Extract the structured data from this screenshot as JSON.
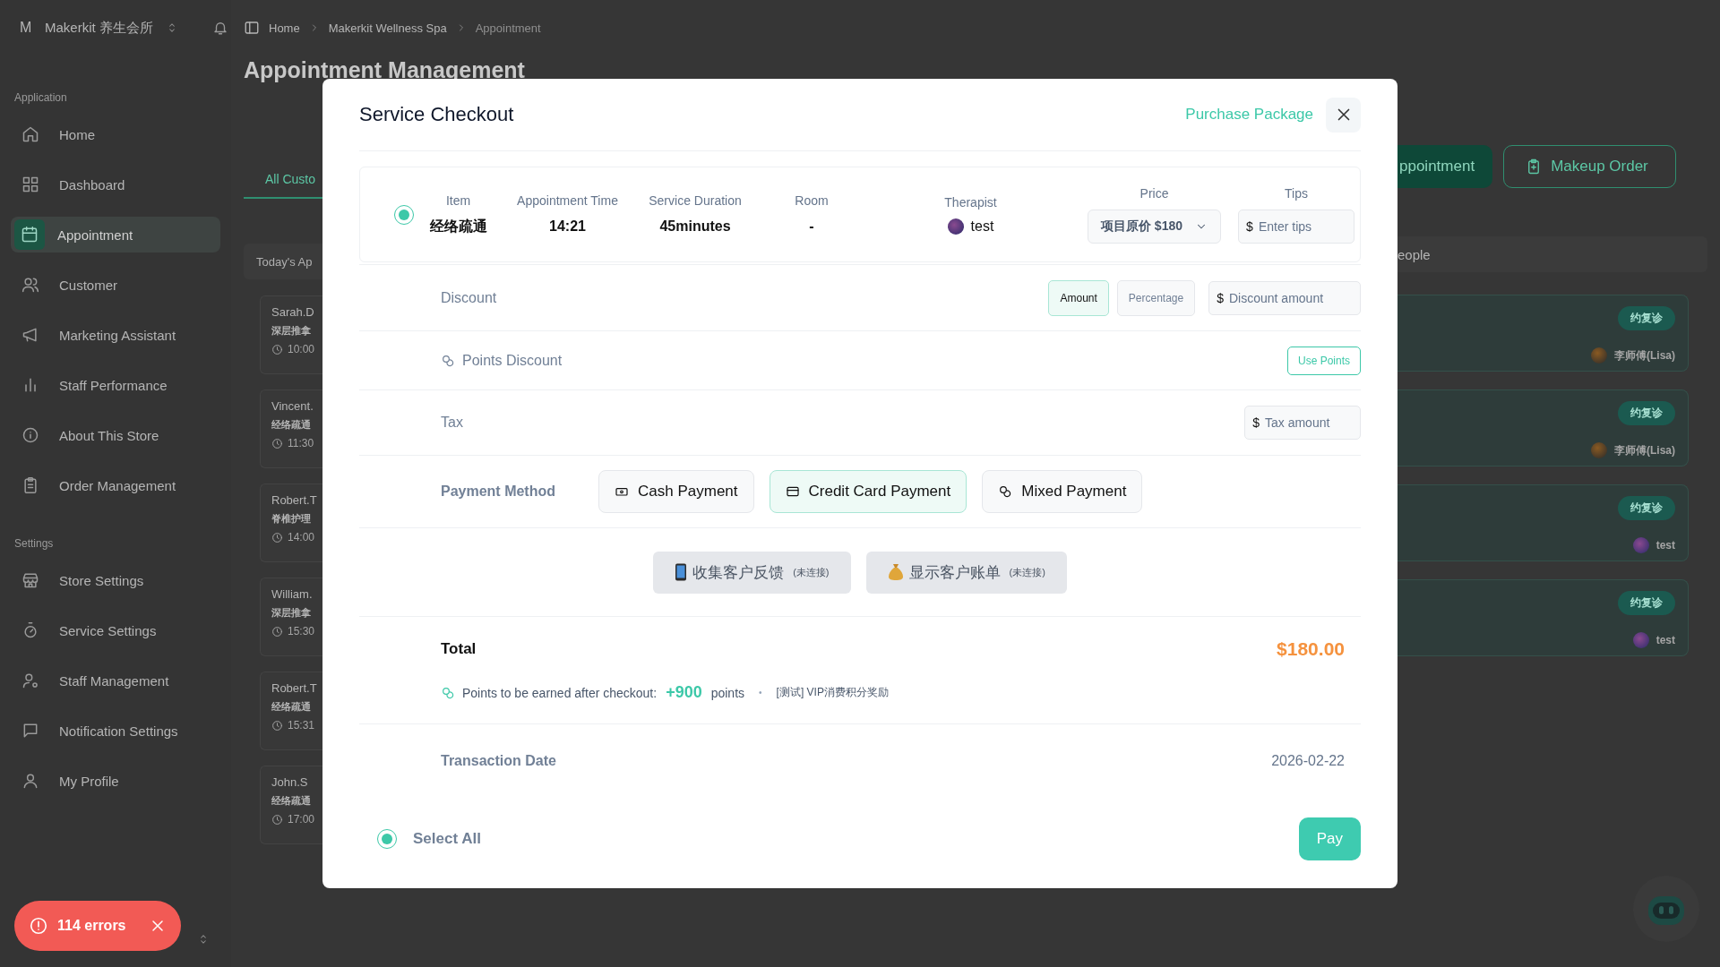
{
  "topbar": {
    "logo_letter": "M",
    "workspace": "Makerkit 养生会所"
  },
  "breadcrumb": [
    {
      "label": "Home",
      "current": false
    },
    {
      "label": "Makerkit Wellness Spa",
      "current": false
    },
    {
      "label": "Appointment",
      "current": true
    }
  ],
  "sidebar": {
    "sections": [
      {
        "title": "Application",
        "items": [
          {
            "label": "Home",
            "selected": false
          },
          {
            "label": "Dashboard",
            "selected": false
          },
          {
            "label": "Appointment",
            "selected": true
          },
          {
            "label": "Customer",
            "selected": false
          },
          {
            "label": "Marketing Assistant",
            "selected": false
          },
          {
            "label": "Staff Performance",
            "selected": false
          },
          {
            "label": "About This Store",
            "selected": false
          },
          {
            "label": "Order Management",
            "selected": false
          }
        ]
      },
      {
        "title": "Settings",
        "items": [
          {
            "label": "Store Settings",
            "selected": false
          },
          {
            "label": "Service Settings",
            "selected": false
          },
          {
            "label": "Staff Management",
            "selected": false
          },
          {
            "label": "Notification Settings",
            "selected": false
          },
          {
            "label": "My Profile",
            "selected": false
          }
        ]
      }
    ]
  },
  "page": {
    "title": "Appointment Management",
    "tabs": [
      {
        "label": "All Custo",
        "selected": true
      }
    ],
    "actions": [
      {
        "label": "ppointment",
        "kind": "primary"
      },
      {
        "label": "Makeup Order",
        "kind": "outline"
      }
    ],
    "left_panel": {
      "header": "Today's Ap",
      "cards": [
        {
          "name": "Sarah.D",
          "service": "深层推拿",
          "time": "10:00"
        },
        {
          "name": "Vincent.",
          "service": "经络疏通",
          "time": "11:30"
        },
        {
          "name": "Robert.T",
          "service": "脊椎护理",
          "time": "14:00"
        },
        {
          "name": "William.",
          "service": "深层推拿",
          "time": "15:30"
        },
        {
          "name": "Robert.T",
          "service": "经络疏通",
          "time": "15:31"
        },
        {
          "name": "John.S",
          "service": "经络疏通",
          "time": "17:00"
        }
      ]
    },
    "right_panel": {
      "header": "eople",
      "cards": [
        {
          "badge": "约复诊",
          "therapist": "李师傅(Lisa)"
        },
        {
          "badge": "约复诊",
          "therapist": "李师傅(Lisa)"
        },
        {
          "badge": "约复诊",
          "therapist": "test"
        },
        {
          "badge": "约复诊",
          "therapist": "test"
        }
      ]
    }
  },
  "error_toast": {
    "text": "114 errors"
  },
  "modal": {
    "title": "Service Checkout",
    "header_link": "Purchase Package",
    "item": {
      "selected": true,
      "columns": [
        {
          "kind": "text",
          "label": "Item",
          "value": "经络疏通"
        },
        {
          "kind": "text",
          "label": "Appointment Time",
          "value": "14:21"
        },
        {
          "kind": "text",
          "label": "Service Duration",
          "value": "45minutes"
        },
        {
          "kind": "text",
          "label": "Room",
          "value": "-"
        },
        {
          "kind": "person",
          "label": "Therapist",
          "value": "test"
        },
        {
          "kind": "select",
          "label": "Price",
          "value": "项目原价 $180"
        },
        {
          "kind": "input",
          "label": "Tips",
          "prefix": "$",
          "placeholder": "Enter tips"
        }
      ]
    },
    "discount": {
      "label": "Discount",
      "types": [
        {
          "label": "Amount",
          "selected": true
        },
        {
          "label": "Percentage",
          "selected": false
        }
      ],
      "prefix": "$",
      "placeholder": "Discount amount"
    },
    "points_discount": {
      "label": "Points Discount",
      "button": "Use Points"
    },
    "tax": {
      "label": "Tax",
      "prefix": "$",
      "placeholder": "Tax amount"
    },
    "payment_method": {
      "label": "Payment Method",
      "options": [
        {
          "label": "Cash Payment",
          "selected": false
        },
        {
          "label": "Credit Card Payment",
          "selected": true
        },
        {
          "label": "Mixed Payment",
          "selected": false
        }
      ]
    },
    "devices": [
      {
        "label": "收集客户反馈",
        "note": "(未连接)"
      },
      {
        "label": "显示客户账单",
        "note": "(未连接)"
      }
    ],
    "total": {
      "label": "Total",
      "amount": "$180.00"
    },
    "points_earned": {
      "text": "Points to be earned after checkout:",
      "amount": "+900",
      "unit": "points",
      "separator": "•",
      "note": "[测试] VIP消费积分奖励"
    },
    "transaction_date": {
      "label": "Transaction Date",
      "value": "2026-02-22"
    },
    "select_all": {
      "label": "Select All",
      "checked": true
    },
    "pay_button": "Pay"
  }
}
